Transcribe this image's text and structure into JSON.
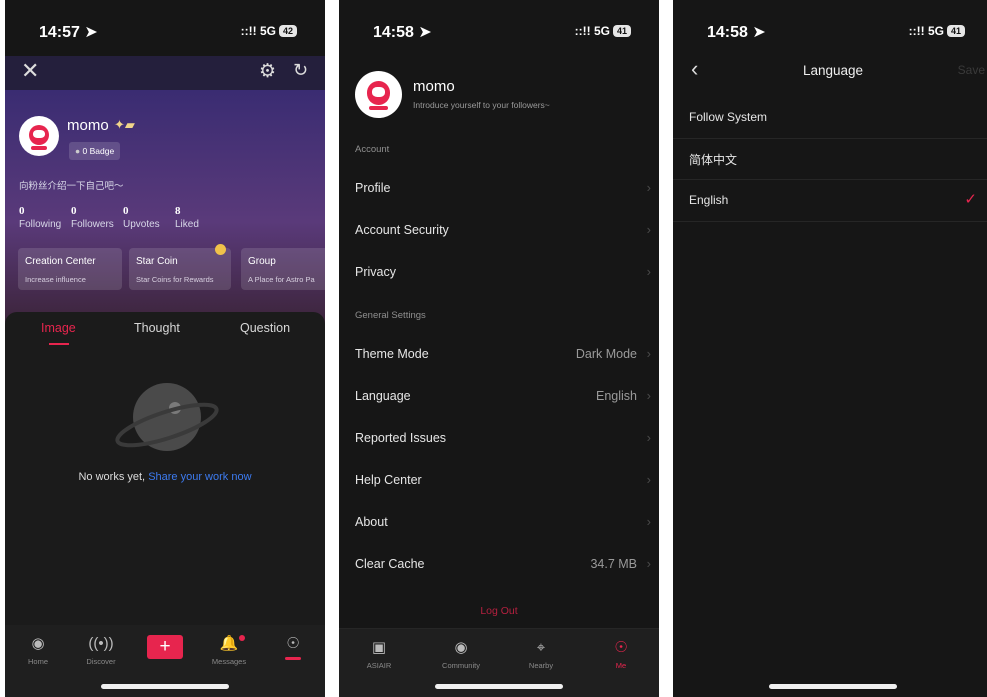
{
  "panel1": {
    "time": "14:57 ➤",
    "network": "::!! 5G",
    "battery": "42",
    "user": {
      "name": "momo",
      "badge": "0 Badge",
      "bio": "向粉丝介绍一下自己吧～"
    },
    "stats": [
      {
        "value": "0",
        "label": "Following"
      },
      {
        "value": "0",
        "label": "Followers"
      },
      {
        "value": "0",
        "label": "Upvotes"
      },
      {
        "value": "8",
        "label": "Liked"
      }
    ],
    "cards": [
      {
        "title": "Creation Center",
        "subtitle": "Increase influence"
      },
      {
        "title": "Star Coin",
        "subtitle": "Star Coins for Rewards"
      },
      {
        "title": "Group",
        "subtitle": "A Place for Astro Pa"
      }
    ],
    "tabs": [
      "Image",
      "Thought",
      "Question"
    ],
    "empty_text": "No works yet,",
    "empty_link": "Share your work now",
    "nav": [
      "Home",
      "Discover",
      "",
      "Messages",
      ""
    ]
  },
  "panel2": {
    "time": "14:58 ➤",
    "network": "::!! 5G",
    "battery": "41",
    "user": {
      "name": "momo",
      "bio": "Introduce yourself to your followers~"
    },
    "section_account": "Account",
    "account_items": [
      "Profile",
      "Account Security",
      "Privacy"
    ],
    "section_general": "General Settings",
    "general_items": [
      {
        "label": "Theme Mode",
        "value": "Dark Mode"
      },
      {
        "label": "Language",
        "value": "English"
      },
      {
        "label": "Reported Issues",
        "value": ""
      },
      {
        "label": "Help Center",
        "value": ""
      },
      {
        "label": "About",
        "value": ""
      },
      {
        "label": "Clear Cache",
        "value": "34.7 MB"
      }
    ],
    "logout": "Log Out",
    "nav": [
      "ASIAIR",
      "Community",
      "Nearby",
      "Me"
    ]
  },
  "panel3": {
    "time": "14:58 ➤",
    "network": "::!! 5G",
    "battery": "41",
    "title": "Language",
    "save": "Save",
    "options": [
      "Follow System",
      "简体中文",
      "English"
    ]
  },
  "colors": {
    "accent": "#e7254e",
    "link": "#3d7bf0",
    "background": "#161616"
  }
}
